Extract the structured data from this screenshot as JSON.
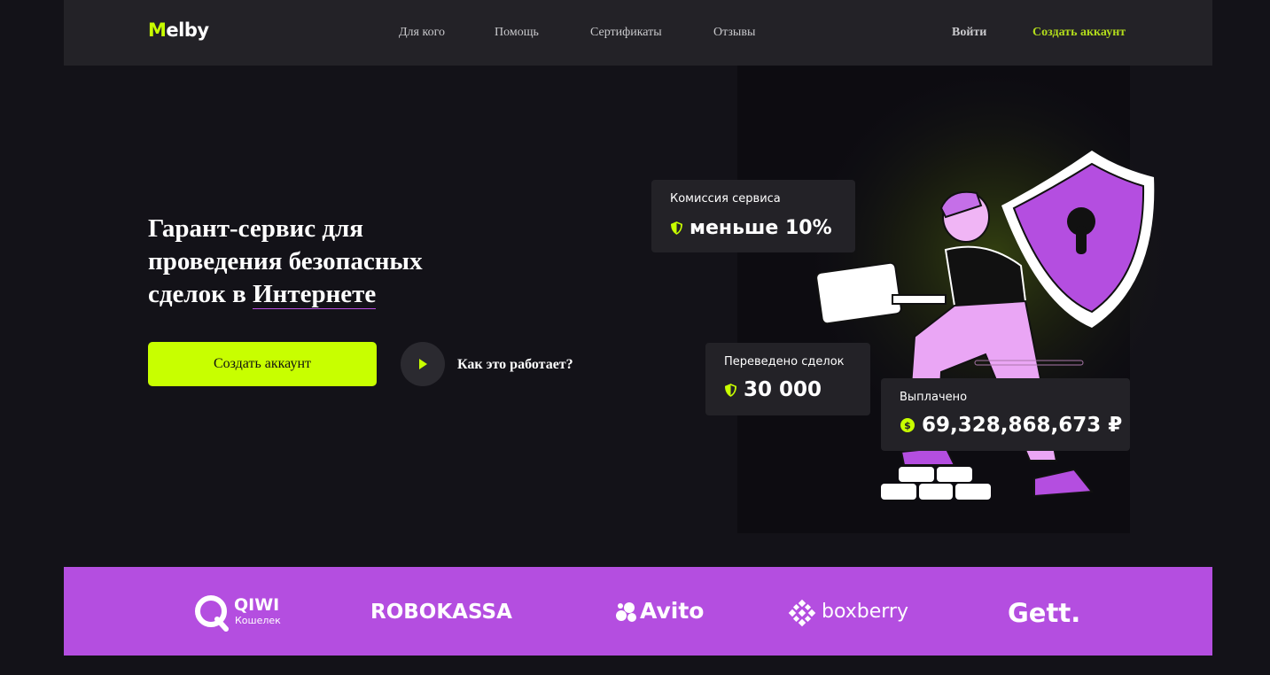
{
  "header": {
    "logo_first": "M",
    "logo_rest": "elby",
    "nav": [
      "Для кого",
      "Помощь",
      "Сертификаты",
      "Отзывы"
    ],
    "login": "Войти",
    "signup": "Создать аккаунт"
  },
  "hero": {
    "title_part": "Гарант-сервис для проведения безопасных сделок в ",
    "title_highlight": "Интернете",
    "cta": "Создать аккаунт",
    "how": "Как это работает?"
  },
  "stats": {
    "commission_label": "Комиссия сервиса",
    "commission_value": "меньше 10%",
    "deals_label": "Переведено сделок",
    "deals_value": "30 000",
    "paid_label": "Выплачено",
    "paid_value": "69,328,868,673 ₽"
  },
  "partners": {
    "qiwi": "QIWI",
    "qiwi_sub": "Кошелек",
    "robokassa": "ROBOKASSA",
    "avito": "Avito",
    "boxberry": "boxberry",
    "gett": "Gett."
  },
  "colors": {
    "accent": "#c8ff00",
    "purple": "#b44ee0",
    "bg": "#131218",
    "card": "#232227"
  }
}
